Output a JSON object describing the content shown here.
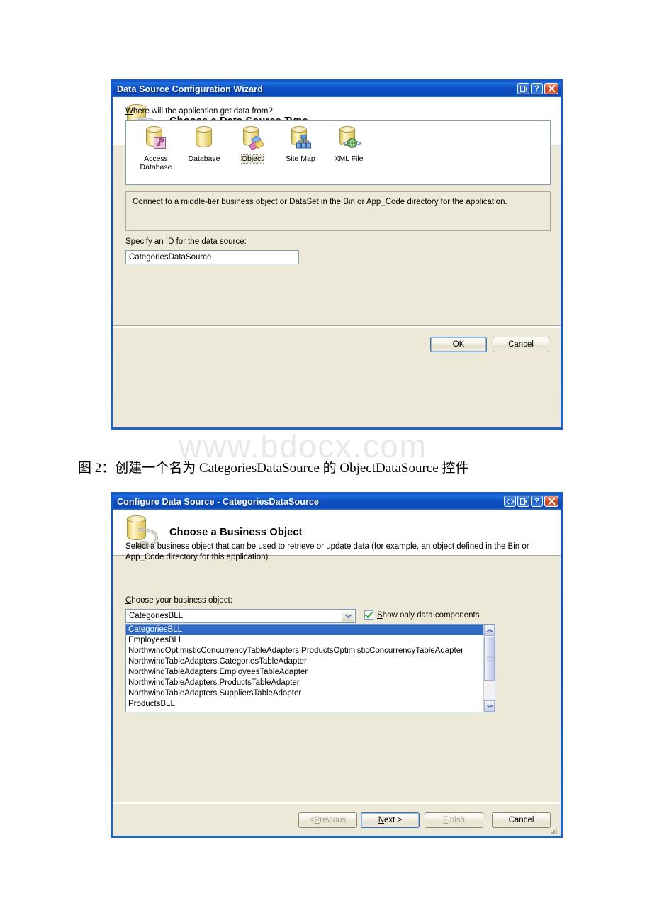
{
  "page": {
    "watermark": "www.bdocx.com",
    "caption": "图 2：创建一个名为 CategoriesDataSource 的 ObjectDataSource 控件"
  },
  "dialog1": {
    "title": "Data Source Configuration Wizard",
    "header_title": "Choose a Data Source Type",
    "header_icon": "database-plug-icon",
    "titlebar_buttons": [
      {
        "name": "restore-dock-button",
        "glyph": "dock"
      },
      {
        "name": "help-button",
        "glyph": "?"
      },
      {
        "name": "close-button",
        "glyph": "x"
      }
    ],
    "prompt_label": "Where will the application get data from?",
    "prompt_accesskey": "W",
    "data_sources": [
      {
        "label": "Access Database",
        "icon": "access-database-icon",
        "selected": false
      },
      {
        "label": "Database",
        "icon": "database-icon",
        "selected": false
      },
      {
        "label": "Object",
        "icon": "object-icon",
        "selected": true
      },
      {
        "label": "Site Map",
        "icon": "site-map-icon",
        "selected": false
      },
      {
        "label": "XML File",
        "icon": "xml-file-icon",
        "selected": false
      }
    ],
    "description": "Connect to a middle-tier business object or DataSet in the Bin or App_Code directory for the application.",
    "id_label": "Specify an ID for the data source:",
    "id_accesskey": "ID",
    "id_value": "CategoriesDataSource",
    "buttons": [
      {
        "label": "OK",
        "name": "ok-button",
        "default": true,
        "disabled": false
      },
      {
        "label": "Cancel",
        "name": "cancel-button",
        "default": false,
        "disabled": false
      }
    ]
  },
  "dialog2": {
    "title": "Configure Data Source - CategoriesDataSource",
    "header_title": "Choose a Business Object",
    "header_icon": "database-plug-icon",
    "titlebar_buttons": [
      {
        "name": "resize-button",
        "glyph": "resize"
      },
      {
        "name": "restore-dock-button",
        "glyph": "dock"
      },
      {
        "name": "help-button",
        "glyph": "?"
      },
      {
        "name": "close-button",
        "glyph": "x"
      }
    ],
    "description": "Select a business object that can be used to retrieve or update data (for example, an object defined in the Bin or App_Code directory for this application).",
    "combo_label": "Choose your business object:",
    "combo_accesskey": "C",
    "combo_value": "CategoriesBLL",
    "checkbox": {
      "label": "Show only data components",
      "accesskey": "S",
      "checked": true
    },
    "list_items": [
      {
        "label": "CategoriesBLL",
        "selected": true
      },
      {
        "label": "EmployeesBLL",
        "selected": false
      },
      {
        "label": "NorthwindOptimisticConcurrencyTableAdapters.ProductsOptimisticConcurrencyTableAdapter",
        "selected": false
      },
      {
        "label": "NorthwindTableAdapters.CategoriesTableAdapter",
        "selected": false
      },
      {
        "label": "NorthwindTableAdapters.EmployeesTableAdapter",
        "selected": false
      },
      {
        "label": "NorthwindTableAdapters.ProductsTableAdapter",
        "selected": false
      },
      {
        "label": "NorthwindTableAdapters.SuppliersTableAdapter",
        "selected": false
      },
      {
        "label": "ProductsBLL",
        "selected": false
      }
    ],
    "buttons": [
      {
        "label": "< Previous",
        "name": "previous-button",
        "default": false,
        "disabled": true
      },
      {
        "label": "Next >",
        "name": "next-button",
        "default": true,
        "disabled": false
      },
      {
        "label": "Finish",
        "name": "finish-button",
        "default": false,
        "disabled": true
      },
      {
        "label": "Cancel",
        "name": "cancel-button",
        "default": false,
        "disabled": false
      }
    ]
  },
  "colors": {
    "titlebar_blue": "#0b4ab8",
    "dialog_bg": "#ece9d8",
    "selection_blue": "#316ac5",
    "close_red": "#d8512a",
    "field_border": "#7f9db9"
  }
}
